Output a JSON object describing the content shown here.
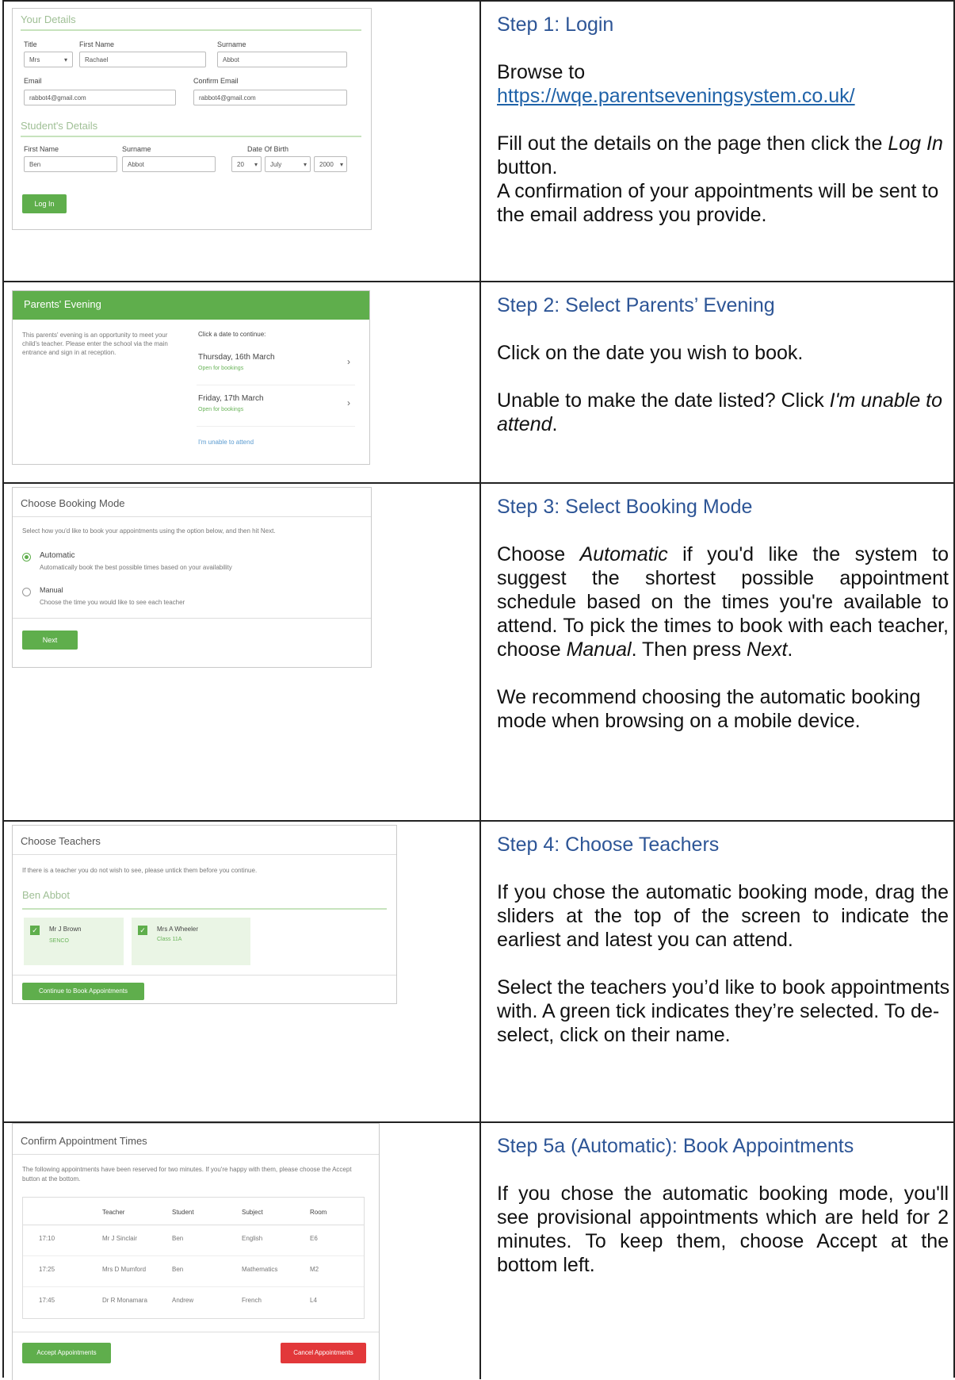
{
  "step1": {
    "title": "Step 1: Login",
    "browse": "Browse to",
    "url": "https://wqe.parentseveningsystem.co.uk/",
    "fill_pre": "Fill out the details on the page then click the ",
    "fill_btn": "Log In",
    "fill_post": " button.",
    "confirm": "A confirmation of your appointments will be sent to the email address you provide.",
    "shot": {
      "your_details": "Your Details",
      "title_label": "Title",
      "title_value": "Mrs",
      "first_name_label": "First Name",
      "first_name_value": "Rachael",
      "surname_label": "Surname",
      "surname_value": "Abbot",
      "email_label": "Email",
      "email_value": "rabbot4@gmail.com",
      "confirm_email_label": "Confirm Email",
      "confirm_email_value": "rabbot4@gmail.com",
      "students_details": "Student's Details",
      "s_first_name_label": "First Name",
      "s_first_name_value": "Ben",
      "s_surname_label": "Surname",
      "s_surname_value": "Abbot",
      "dob_label": "Date Of Birth",
      "dob_day": "20",
      "dob_month": "July",
      "dob_year": "2000",
      "login_button": "Log In"
    }
  },
  "step2": {
    "title": "Step 2: Select Parents’ Evening",
    "click": "Click on the date you wish to book.",
    "unable_pre": "Unable to make the date listed? Click ",
    "unable_em": "I'm unable to attend",
    "unable_post": ".",
    "shot": {
      "header": "Parents' Evening",
      "intro": "This parents' evening is an opportunity to meet your child's teacher. Please enter the school via the main entrance and sign in at reception.",
      "click_date": "Click a date to continue:",
      "date1": "Thursday, 16th March",
      "date1_status": "Open for bookings",
      "date2": "Friday, 17th March",
      "date2_status": "Open for bookings",
      "unable": "I'm unable to attend"
    }
  },
  "step3": {
    "title": "Step 3: Select Booking Mode",
    "p1_a": "Choose ",
    "p1_auto": "Automatic",
    "p1_b": " if you'd like the system to suggest the shortest possible appointment schedule based on the times you're available to attend. To pick the times to book with each teacher, choose ",
    "p1_manual": "Manual",
    "p1_c": ". Then press ",
    "p1_next": "Next",
    "p1_d": ".",
    "p2": "We recommend choosing the automatic booking mode when browsing on a mobile device.",
    "shot": {
      "header": "Choose Booking Mode",
      "intro": "Select how you'd like to book your appointments using the option below, and then hit Next.",
      "auto_label": "Automatic",
      "auto_desc": "Automatically book the best possible times based on your availability",
      "manual_label": "Manual",
      "manual_desc": "Choose the time you would like to see each teacher",
      "next_button": "Next"
    }
  },
  "step4": {
    "title": "Step 4: Choose Teachers",
    "p1": "If you chose the automatic booking mode, drag the sliders at the top of the screen to indicate the earliest and latest you can attend.",
    "p2": "Select the teachers you’d like to book appointments with. A green tick indicates they’re selected. To de-select, click on their name.",
    "shot": {
      "header": "Choose Teachers",
      "intro": "If there is a teacher you do not wish to see, please untick them before you continue.",
      "student": "Ben Abbot",
      "t1_name": "Mr J Brown",
      "t1_sub": "SENCO",
      "t2_name": "Mrs A Wheeler",
      "t2_sub": "Class 11A",
      "continue_button": "Continue to Book Appointments"
    }
  },
  "step5": {
    "title": "Step 5a (Automatic): Book Appointments",
    "p1": "If you chose the automatic booking mode, you'll see provisional appointments which are held for 2 minutes. To keep them, choose Accept at the bottom left.",
    "shot": {
      "header": "Confirm Appointment Times",
      "intro": "The following appointments have been reserved for two minutes. If you're happy with them, please choose the Accept button at the bottom.",
      "columns": [
        "",
        "Teacher",
        "Student",
        "Subject",
        "Room"
      ],
      "rows": [
        [
          "17:10",
          "Mr J Sinclair",
          "Ben",
          "English",
          "E6"
        ],
        [
          "17:25",
          "Mrs D Mumford",
          "Ben",
          "Mathematics",
          "M2"
        ],
        [
          "17:45",
          "Dr R Monamara",
          "Andrew",
          "French",
          "L4"
        ]
      ],
      "accept_button": "Accept Appointments",
      "cancel_button": "Cancel Appointments"
    }
  }
}
